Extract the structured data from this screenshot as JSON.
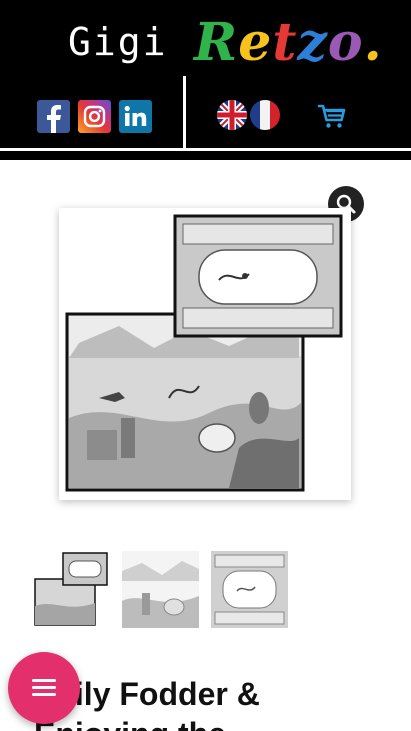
{
  "header": {
    "brand_first": "Gigi",
    "brand_last_letters": [
      "R",
      "e",
      "t",
      "z",
      "o",
      "."
    ],
    "brand_last_colors": [
      "#2fb34a",
      "#f7c21b",
      "#e53935",
      "#2d7fd8",
      "#9b59b6",
      "#f7c21b"
    ],
    "social": [
      {
        "icon": "facebook-icon",
        "color": "#3b5998"
      },
      {
        "icon": "instagram-icon",
        "color": "#c13584"
      },
      {
        "icon": "linkedin-icon",
        "color": "#0e76a8"
      }
    ],
    "languages": [
      {
        "icon": "uk-flag-icon"
      },
      {
        "icon": "france-flag-icon"
      }
    ],
    "cart_icon": "cart-icon",
    "cart_color": "#2b9be0"
  },
  "product": {
    "title": "Daily Fodder & Enjoying the",
    "thumbnails": 3
  },
  "menu_fab": {
    "icon": "menu-icon",
    "color": "#e3306c"
  }
}
